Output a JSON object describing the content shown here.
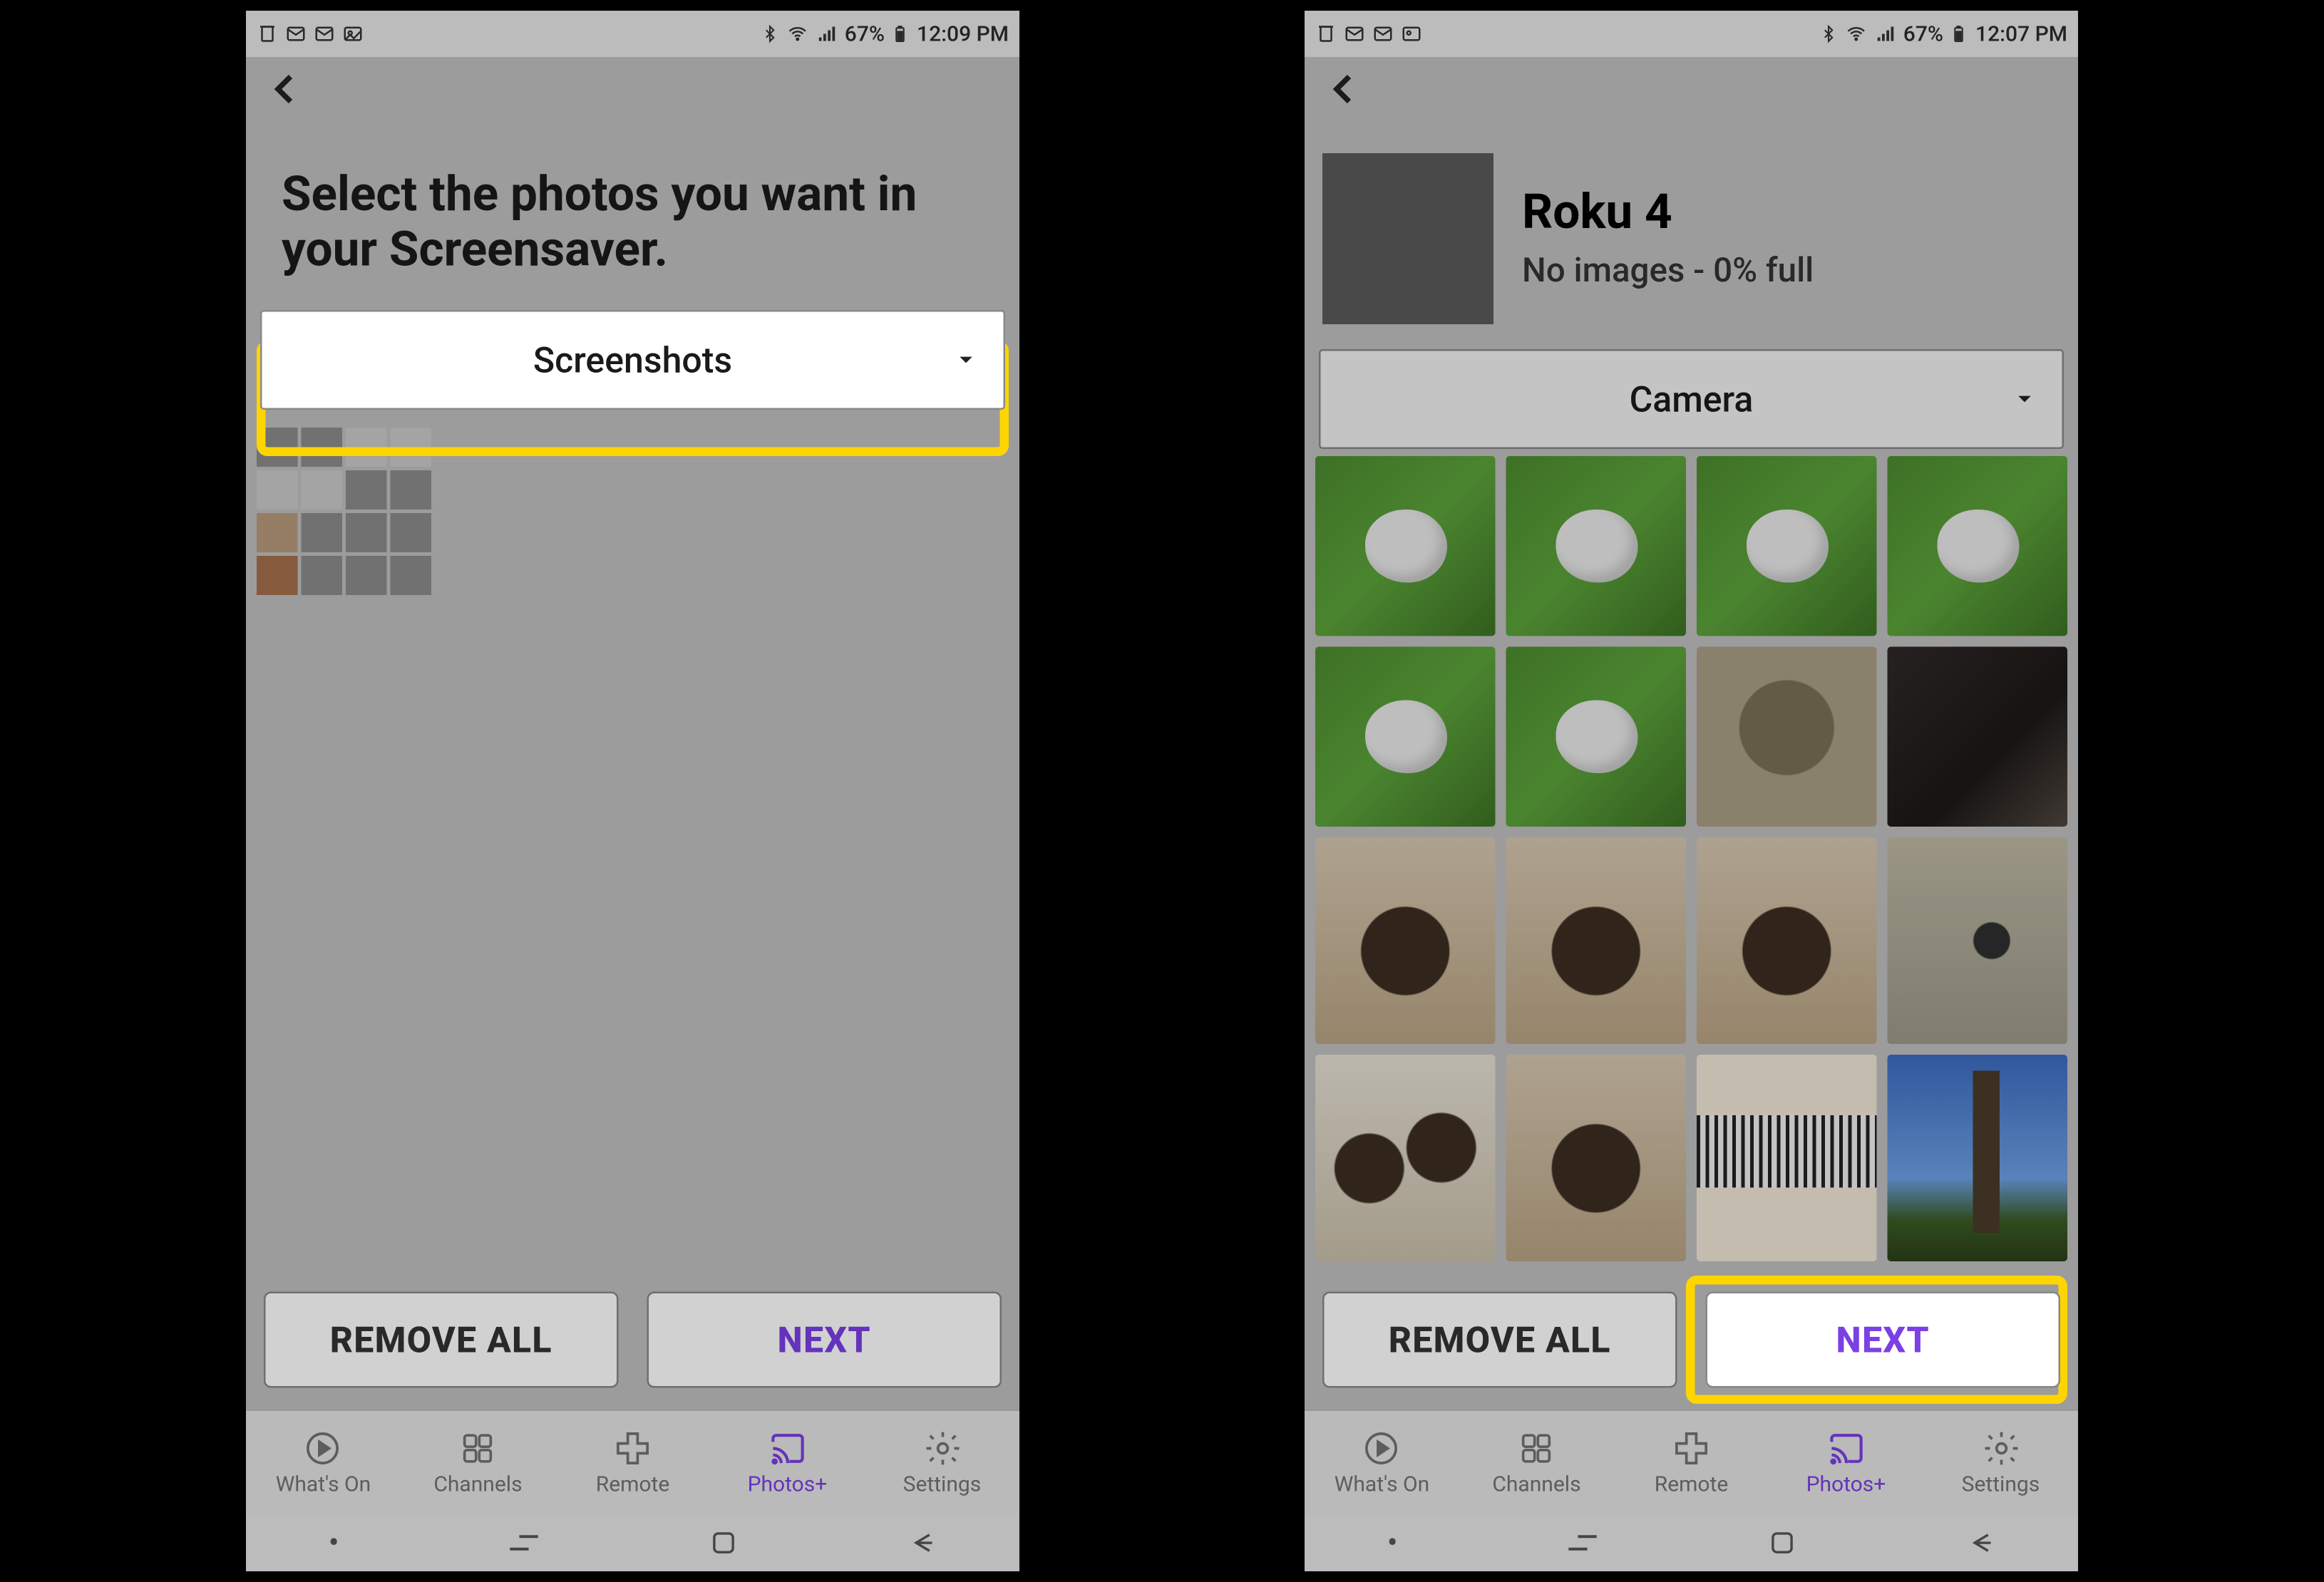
{
  "status": {
    "battery": "67%",
    "timeA": "12:09 PM",
    "timeB": "12:07 PM"
  },
  "left": {
    "title": "Select the photos you want in your Screensaver.",
    "dropdown": "Screenshots"
  },
  "right": {
    "dev_name": "Roku 4",
    "dev_sub": "No images - 0% full",
    "dropdown": "Camera"
  },
  "buttons": {
    "remove": "REMOVE ALL",
    "next": "NEXT"
  },
  "nav": {
    "whats_on": "What's On",
    "channels": "Channels",
    "remote": "Remote",
    "photos": "Photos+",
    "settings": "Settings"
  }
}
